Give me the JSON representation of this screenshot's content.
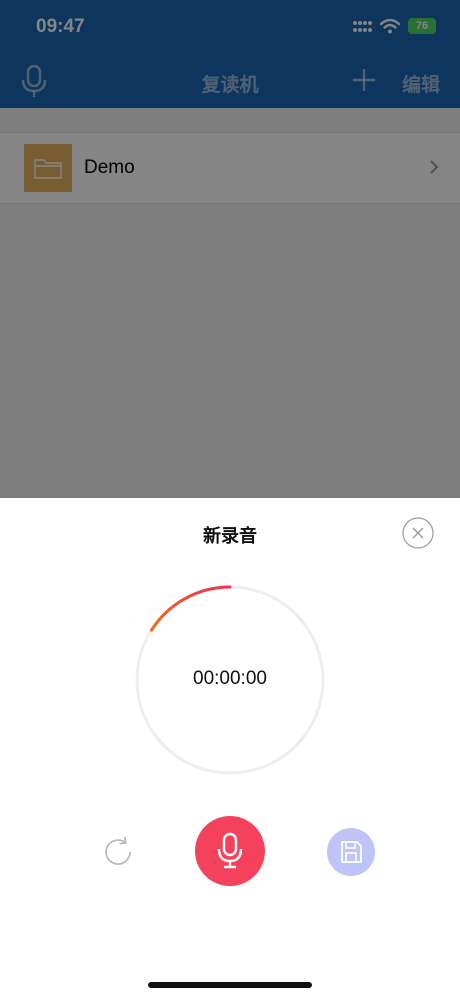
{
  "status_bar": {
    "time": "09:47",
    "battery": "76"
  },
  "nav": {
    "title": "复读机",
    "edit_label": "编辑"
  },
  "list": {
    "items": [
      {
        "label": "Demo",
        "icon": "folder-icon"
      }
    ]
  },
  "recorder": {
    "title": "新录音",
    "timer": "00:00:00",
    "progress": 0.16
  },
  "colors": {
    "nav_bg": "#1a66b4",
    "record": "#f5425c",
    "save": "#bfc4f6",
    "folder": "#e6b263",
    "battery": "#4cd964"
  }
}
